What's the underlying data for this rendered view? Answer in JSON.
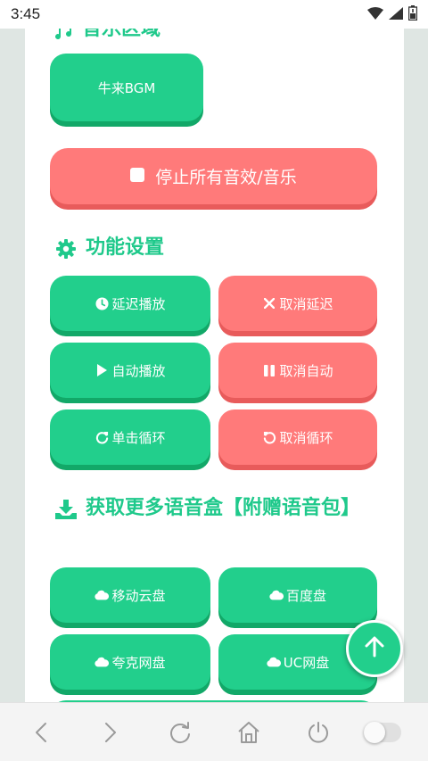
{
  "status_bar": {
    "time": "3:45"
  },
  "music_section": {
    "title": "音乐区域",
    "bgm_button": "牛来BGM"
  },
  "stop_all_button": "停止所有音效/音乐",
  "settings_section": {
    "title": "功能设置",
    "buttons": {
      "delay_play": "延迟播放",
      "cancel_delay": "取消延迟",
      "auto_play": "自动播放",
      "cancel_auto": "取消自动",
      "single_loop": "单击循环",
      "cancel_loop": "取消循环"
    }
  },
  "download_section": {
    "title": "获取更多语音盒【附赠语音包】",
    "buttons": {
      "mobile_cloud": "移动云盘",
      "baidu": "百度盘",
      "quark": "夸克网盘",
      "uc": "UC网盘"
    }
  },
  "colors": {
    "accent_green": "#22cf8c",
    "accent_red": "#ff7a7a"
  },
  "icons": {
    "status": [
      "wifi-icon",
      "signal-icon",
      "battery-icon"
    ],
    "nav": [
      "back-icon",
      "forward-icon",
      "refresh-icon",
      "home-icon",
      "power-icon"
    ]
  }
}
